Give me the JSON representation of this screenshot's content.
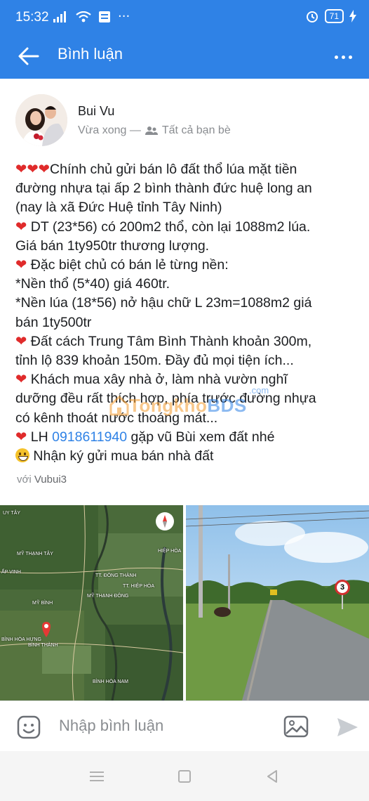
{
  "status_bar": {
    "time": "15:32",
    "battery": "71"
  },
  "app_bar": {
    "title": "Bình luận"
  },
  "post": {
    "author": "Bui Vu",
    "time_label": "Vừa xong —",
    "audience": "Tất cả bạn bè",
    "lines": [
      "Chính chủ gửi bán lô đất thổ lúa mặt tiền",
      "đường nhựa tại ấp 2 bình thành đức huệ long an",
      "(nay là xã Đức Huệ tỉnh Tây Ninh)",
      " DT (23*56) có 200m2 thổ, còn lại 1088m2 lúa.",
      "Giá bán 1ty950tr thương lượng.",
      " Đặc biệt chủ có bán lẻ từng nền:",
      "*Nền thổ (5*40) giá 460tr.",
      "*Nền lúa (18*56) nở hậu chữ L 23m=1088m2 giá",
      "bán 1ty500tr",
      " Đất cách Trung Tâm Bình Thành khoản 300m,",
      "tỉnh lộ 839 khoản 150m. Đầy đủ mọi tiện ích...",
      " Khách mua xây nhà ở, làm nhà vườn nghĩ",
      "dưỡng đều rất thích hợp, phía trước đường nhựa",
      "có kênh thoát nước thoáng mát...",
      " LH ",
      " gặp vũ Bùi xem đất nhé",
      " Nhận ký gửi mua bán nhà đất"
    ],
    "phone": "0918611940",
    "tagged_prefix": "với",
    "tagged_user": "Vubui3",
    "watermark": {
      "part1": "Tongkho",
      "part2": "BDS",
      "domain": ".com"
    },
    "map_labels": [
      "UY TÂY",
      "MỸ THẠNH TÂY",
      "ẤP VINH",
      "TT. HIỆP HÒA",
      "HIỆP HÒA",
      "TT. ĐÔNG THÀNH",
      "MỸ THẠNH ĐÔNG",
      "MỸ BÌNH",
      "BÌNH HÒA HƯNG",
      "BÌNH THÀNH",
      "BÌNH HÒA NAM"
    ],
    "road_sign": "3"
  },
  "comment_bar": {
    "placeholder": "Nhập bình luận"
  },
  "colors": {
    "primary": "#2f82e6",
    "heart": "#e02b2b",
    "muted": "#8a8d91"
  }
}
